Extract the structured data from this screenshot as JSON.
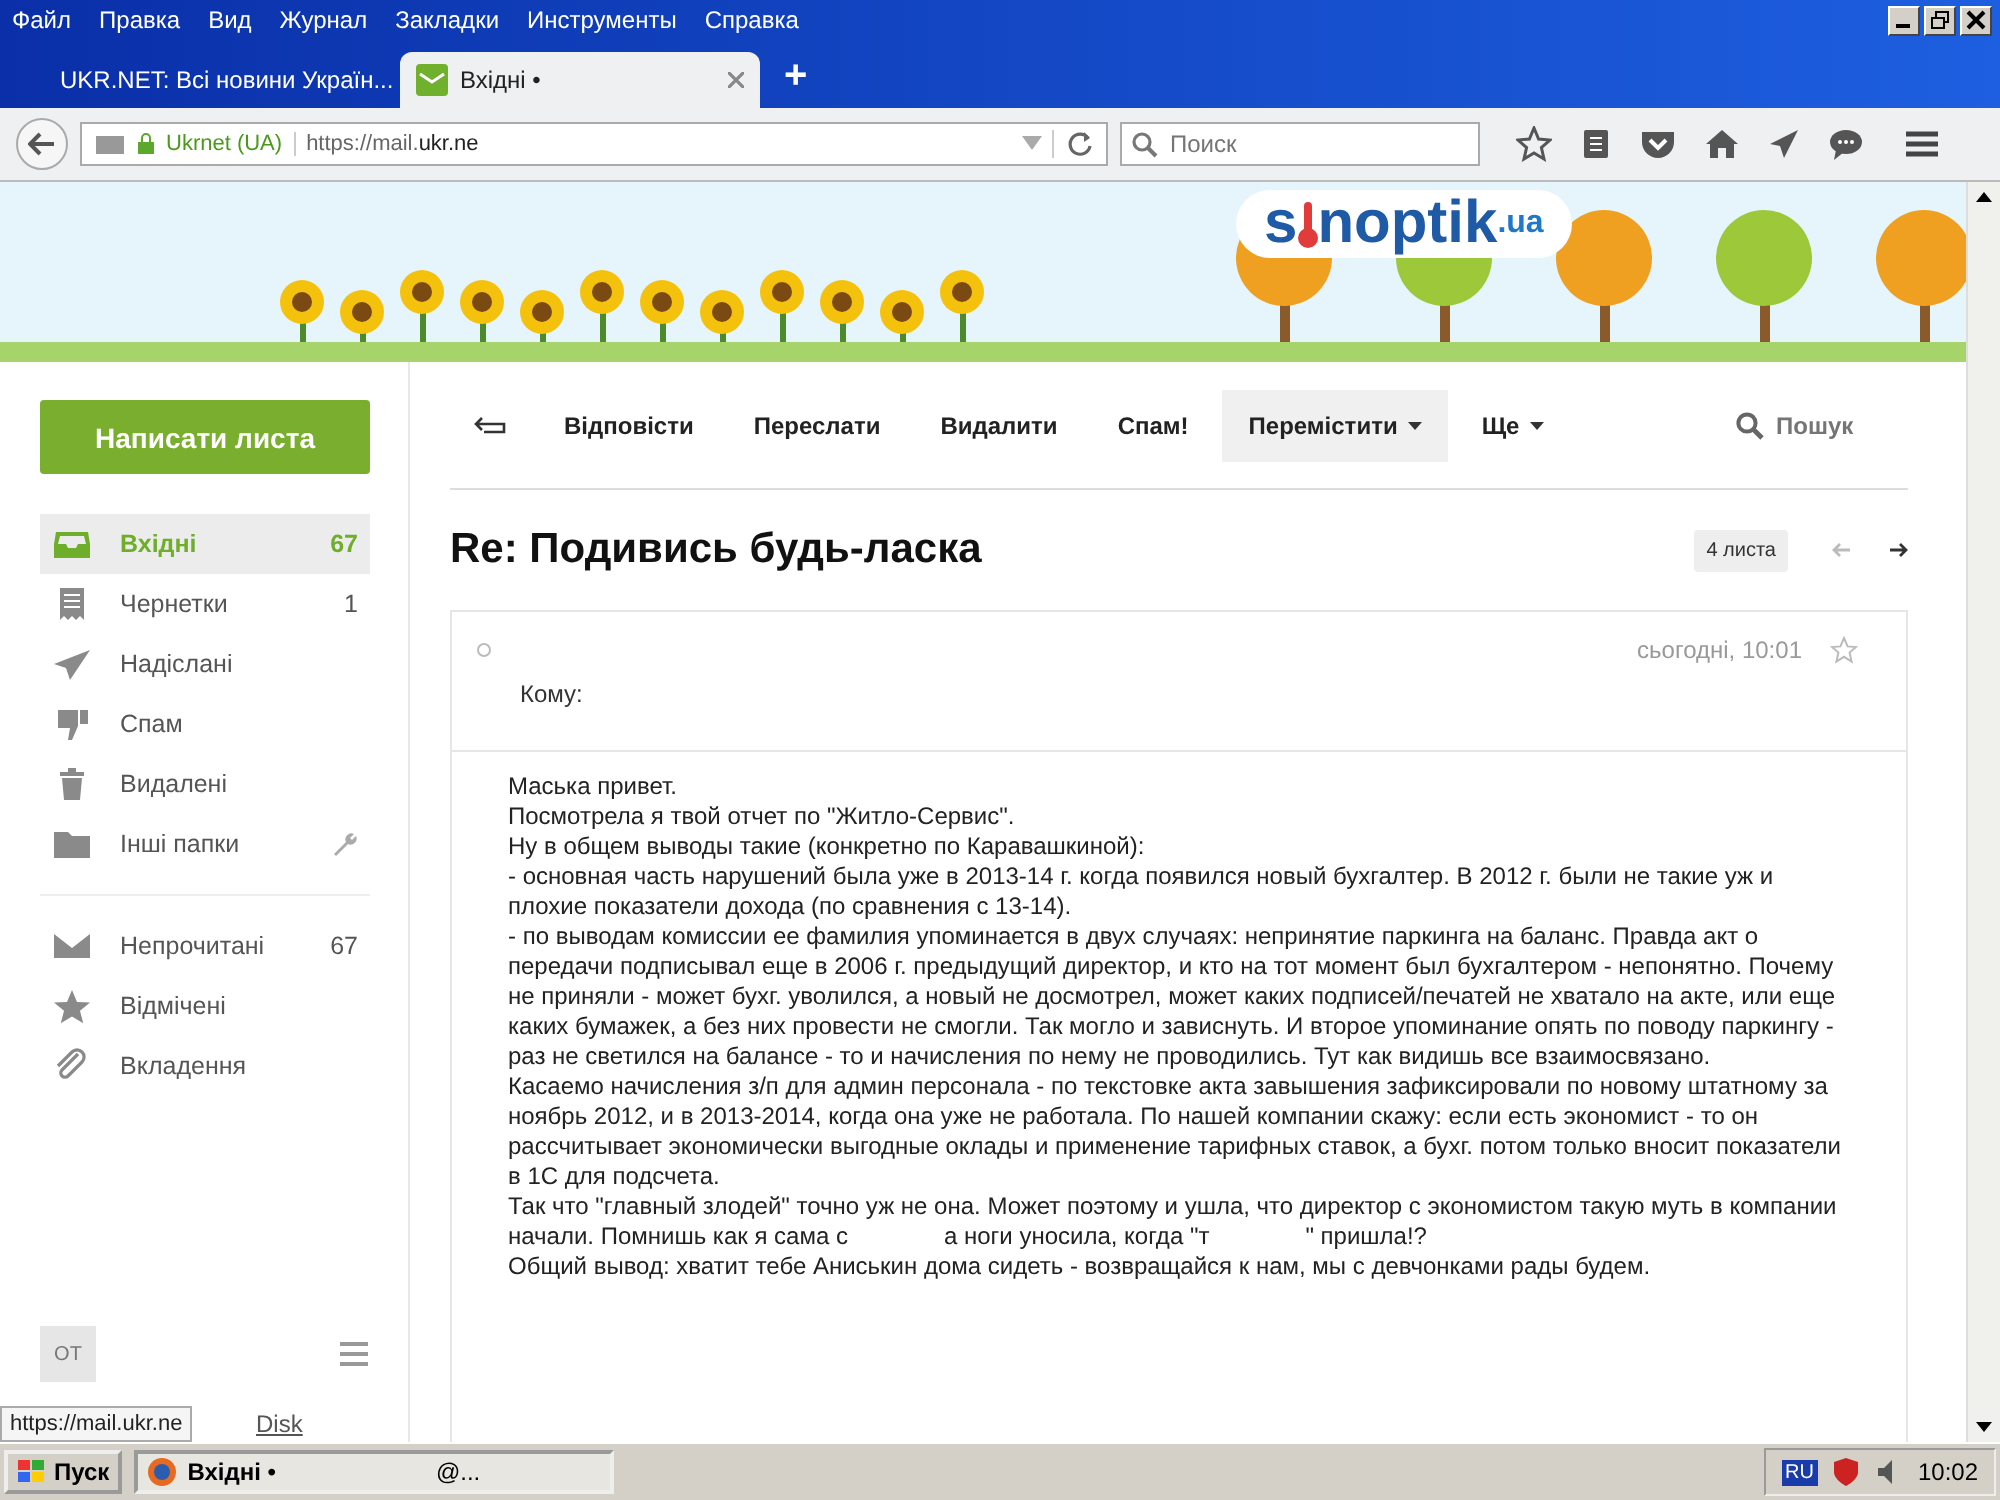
{
  "menu": [
    "Файл",
    "Правка",
    "Вид",
    "Журнал",
    "Закладки",
    "Инструменты",
    "Справка"
  ],
  "tabs": [
    {
      "title": "UKR.NET: Всі новини Україн...",
      "kind": "news",
      "selected": false
    },
    {
      "title": "Вхідні •",
      "kind": "mail",
      "selected": true
    }
  ],
  "new_tab": "+",
  "address": {
    "site": "Ukrnet (UA)",
    "url_prefix": "https://mail.",
    "url_host": "ukr.ne"
  },
  "search": {
    "placeholder": "Поиск"
  },
  "banner": {
    "logo": [
      "s",
      "noptik",
      ".ua"
    ]
  },
  "compose": "Написати листа",
  "folders": [
    {
      "kind": "inbox",
      "label": "Вхідні",
      "count": "67",
      "selected": true
    },
    {
      "kind": "draft",
      "label": "Чернетки",
      "count": "1",
      "selected": false
    },
    {
      "kind": "sent",
      "label": "Надіслані",
      "selected": false
    },
    {
      "kind": "spam",
      "label": "Спам",
      "selected": false
    },
    {
      "kind": "trash",
      "label": "Видалені",
      "selected": false
    },
    {
      "kind": "folder",
      "label": "Інші папки",
      "tool": true,
      "selected": false
    }
  ],
  "filters": [
    {
      "kind": "unread",
      "label": "Непрочитані",
      "count": "67",
      "selected": false
    },
    {
      "kind": "star",
      "label": "Відмічені",
      "selected": false
    },
    {
      "kind": "clip",
      "label": "Вкладення",
      "selected": false
    }
  ],
  "user": {
    "initials": "ОТ"
  },
  "disk": "Disk",
  "actions": [
    {
      "label": "Відповісти",
      "dropdown": false,
      "selected": false
    },
    {
      "label": "Переслати",
      "dropdown": false,
      "selected": false
    },
    {
      "label": "Видалити",
      "dropdown": false,
      "selected": false
    },
    {
      "label": "Спам!",
      "dropdown": false,
      "selected": false
    },
    {
      "label": "Перемістити",
      "dropdown": true,
      "selected": true
    },
    {
      "label": "Ще",
      "dropdown": true,
      "selected": false
    }
  ],
  "mail_search": {
    "placeholder": "Пошук"
  },
  "subject": "Re: Подивись будь-ласка",
  "count_badge": "4 листа",
  "message": {
    "date": "сьогодні, 10:01",
    "to_label": "Кому:",
    "starred": false,
    "body": [
      [
        "Маська привет."
      ],
      [
        "Посмотрела я твой отчет по \"Житло-Сервис\"."
      ],
      [
        "Ну в общем выводы такие (конкретно по Каравашкиной):"
      ],
      [
        "- основная часть нарушений была уже в 2013-14 г. когда появился новый бухгалтер. В 2012 г. были не такие уж и плохие показатели дохода (по сравнения с 13-14)."
      ],
      [
        "- по выводам комиссии ее фамилия упоминается в двух случаях: непринятие паркинга на баланс. Правда акт о передачи подписывал еще в 2006 г. предыдущий директор, и кто на тот момент был бухгалтером - непонятно. Почему не приняли - может бухг. уволился, а новый не досмотрел, может каких подписей/печатей не хватало на акте, или еще каких бумажек, а без них провести не смогли. Так могло и зависнуть. И второе упоминание опять по поводу паркингу - раз не светился на балансе - то и начисления по нему не проводились. Тут как видишь все взаимосвязано."
      ],
      [
        "Касаемо начисления з/п для админ персонала - по  текстовке акта завышения зафиксировали по новому штатному за ноябрь 2012, и в 2013-2014, когда она уже не работала. По нашей компании скажу: если есть экономист - то он рассчитывает экономически выгодные  оклады  и применение тарифных ставок, а бухг. потом только вносит показатели в 1С для подсчета."
      ],
      [
        "Так что \"главный злодей\" точно уж не она. Может поэтому и ушла, что директор с экономистом такую муть в компании начали. Помнишь как я сама с",
        "а ноги уносила, когда \"т",
        "\" пришла!?"
      ],
      [
        "Общий вывод: хватит тебе Аниськин дома сидеть - возвращайся к нам, мы с девчонками рады будем."
      ]
    ]
  },
  "status_url": "https://mail.ukr.ne",
  "taskbar": {
    "start": "Пуск",
    "task": "Вхідні •",
    "task_tail": "@...",
    "lang": "RU",
    "clock": "10:02"
  }
}
